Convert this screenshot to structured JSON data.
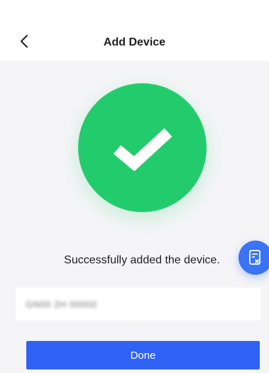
{
  "header": {
    "title": "Add Device",
    "back_icon": "chevron-left-icon"
  },
  "success": {
    "icon": "checkmark-icon",
    "message": "Successfully added the device.",
    "color": "#22cc6c"
  },
  "float_button": {
    "icon": "document-edit-icon",
    "color": "#3a73f6"
  },
  "device": {
    "name": "GN00 2H 00000"
  },
  "actions": {
    "done_label": "Done",
    "color": "#2f62f4"
  }
}
